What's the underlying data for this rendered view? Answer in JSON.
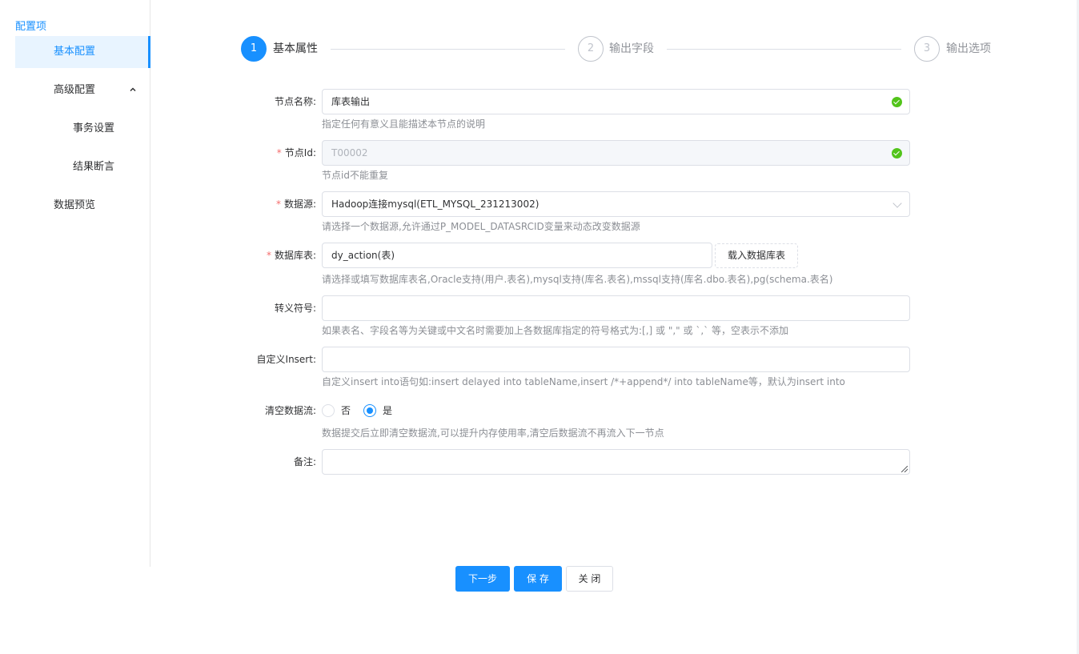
{
  "sidebar": {
    "title": "配置项",
    "items": [
      {
        "label": "基本配置"
      },
      {
        "label": "高级配置"
      },
      {
        "label": "事务设置"
      },
      {
        "label": "结果断言"
      },
      {
        "label": "数据预览"
      }
    ]
  },
  "steps": [
    {
      "number": "1",
      "title": "基本属性",
      "status": "active"
    },
    {
      "number": "2",
      "title": "输出字段",
      "status": "wait"
    },
    {
      "number": "3",
      "title": "输出选项",
      "status": "wait"
    }
  ],
  "form": {
    "node_name": {
      "label": "节点名称:",
      "value": "库表输出",
      "hint": "指定任何有意义且能描述本节点的说明"
    },
    "node_id": {
      "label": "节点Id:",
      "value": "T00002",
      "hint": "节点id不能重复"
    },
    "datasource": {
      "label": "数据源:",
      "value": "Hadoop连接mysql(ETL_MYSQL_231213002)",
      "hint": "请选择一个数据源,允许通过P_MODEL_DATASRCID变量来动态改变数据源"
    },
    "db_table": {
      "label": "数据库表:",
      "value": "dy_action(表)",
      "button": "载入数据库表",
      "hint": "请选择或填写数据库表名,Oracle支持(用户.表名),mysql支持(库名.表名),mssql支持(库名.dbo.表名),pg(schema.表名)"
    },
    "escape_symbol": {
      "label": "转义符号:",
      "value": "",
      "hint": "如果表名、字段名等为关键或中文名时需要加上各数据库指定的符号格式为:[,] 或 \",\" 或 `,` 等，空表示不添加"
    },
    "custom_insert": {
      "label": "自定义Insert:",
      "value": "",
      "hint": "自定义insert into语句如:insert delayed into tableName,insert /*+append*/ into tableName等，默认为insert into"
    },
    "clear_stream": {
      "label": "清空数据流:",
      "options": [
        "否",
        "是"
      ],
      "selected": "是",
      "hint": "数据提交后立即清空数据流,可以提升内存使用率,清空后数据流不再流入下一节点"
    },
    "remark": {
      "label": "备注:",
      "value": ""
    }
  },
  "buttons": {
    "next": "下一步",
    "save": "保 存",
    "close": "关 闭"
  },
  "colors": {
    "primary": "#1890ff",
    "success": "#52c41a",
    "required": "#f56c6c"
  }
}
